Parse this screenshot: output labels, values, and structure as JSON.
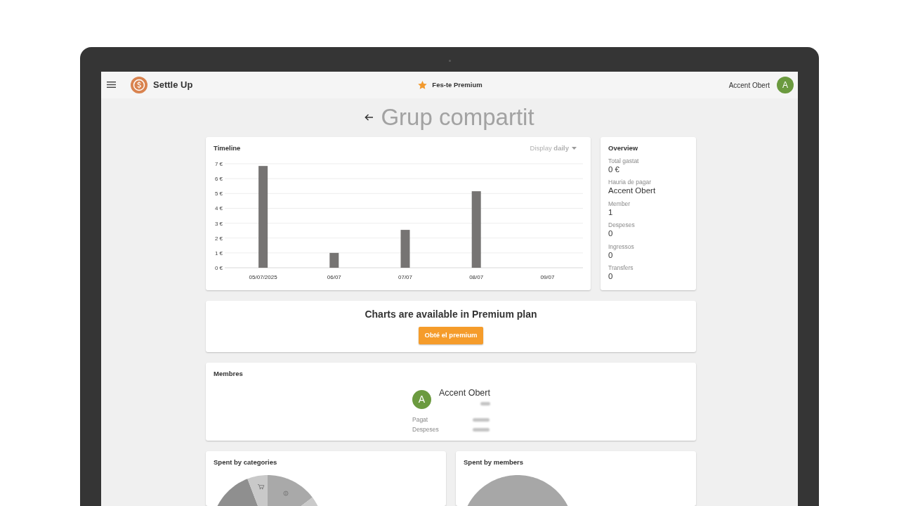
{
  "header": {
    "app_name": "Settle Up",
    "premium_link": "Fes-te Premium",
    "user": {
      "name": "Accent Obert",
      "initial": "A"
    }
  },
  "page": {
    "title": "Grup compartit"
  },
  "timeline": {
    "display": "Display **daily**",
    "chart_data": {
      "type": "bar",
      "title": "Timeline",
      "grid": true,
      "categories": [
        "05/07/2025",
        "06/07",
        "07/07",
        "08/07",
        "09/07"
      ],
      "series": [
        {
          "color": "#767473",
          "values": [
            6.85,
            1,
            2.55,
            5.15,
            0
          ]
        }
      ],
      "ylim": [
        0,
        7
      ],
      "yticks": [
        {
          "value": 0,
          "label": "0 €"
        },
        {
          "value": 1,
          "label": "1 €"
        },
        {
          "value": 2,
          "label": "2 €"
        },
        {
          "value": 3,
          "label": "3 €"
        },
        {
          "value": 4,
          "label": "4 €"
        },
        {
          "value": 5,
          "label": "5 €"
        },
        {
          "value": 6,
          "label": "6 €"
        },
        {
          "value": 7,
          "label": "7 €"
        }
      ]
    }
  },
  "overview": {
    "title": "Overview",
    "stats": [
      {
        "label": "Total gastat",
        "value": "0 €"
      },
      {
        "label": "Hauria de pagar",
        "value": "Accent Obert"
      },
      {
        "label": "Member",
        "value": "1"
      },
      {
        "label": "Despeses",
        "value": "0"
      },
      {
        "label": "Ingressos",
        "value": "0"
      },
      {
        "label": "Transfers",
        "value": "0"
      }
    ]
  },
  "premium_banner": {
    "message": "Charts are available in Premium plan",
    "button": "Obté el premium"
  },
  "members": {
    "title": "Membres",
    "list": [
      {
        "name": "Accent Obert",
        "initial": "A",
        "rows": [
          {
            "label": "Pagat"
          },
          {
            "label": "Despeses"
          }
        ]
      }
    ]
  },
  "spent_by_categories": {
    "title": "Spent by categories"
  },
  "spent_by_members": {
    "title": "Spent by members"
  }
}
